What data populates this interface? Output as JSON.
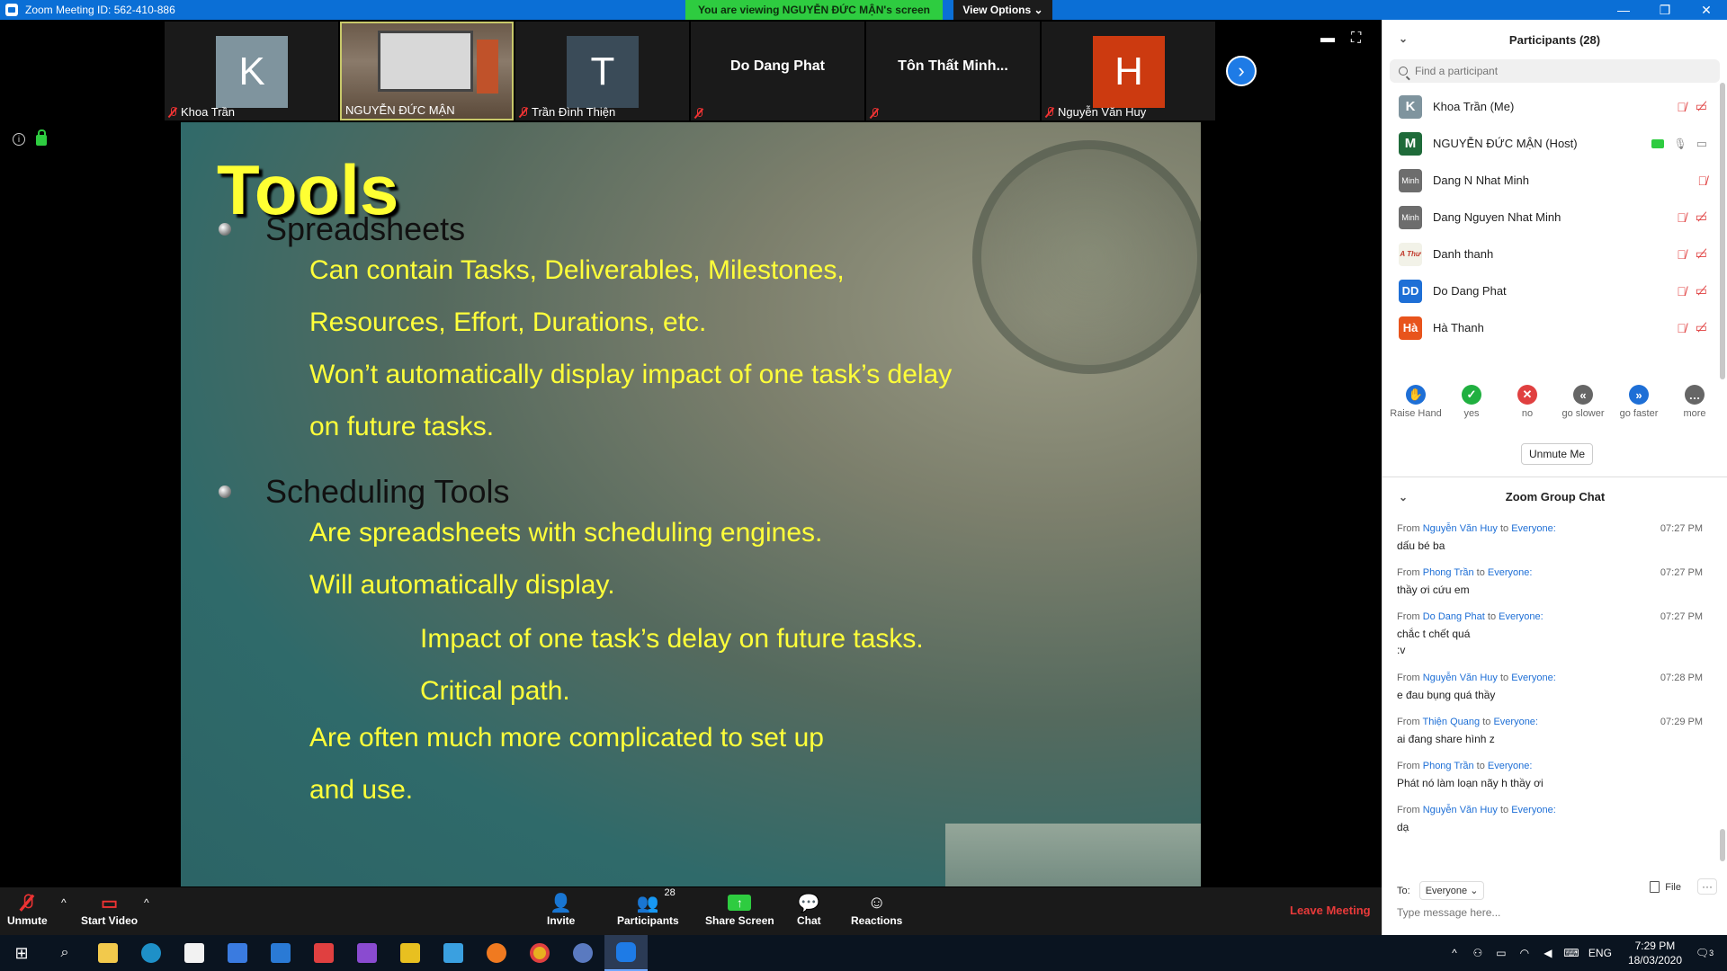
{
  "window": {
    "title": "Zoom Meeting ID: 562-410-886",
    "banner": "You are viewing NGUYỄN ĐỨC MẬN's screen",
    "view_options": "View Options"
  },
  "thumbnails": [
    {
      "type": "avatar",
      "initial": "K",
      "color": "#7f949e",
      "name": "Khoa Trần",
      "muted": true
    },
    {
      "type": "camera",
      "name": "NGUYỄN ĐỨC MẬN",
      "muted": false
    },
    {
      "type": "avatar",
      "initial": "T",
      "color": "#3a4b58",
      "name": "Trần Đình Thiện",
      "muted": true
    },
    {
      "type": "name",
      "display": "Do Dang Phat",
      "name": "",
      "muted": true
    },
    {
      "type": "name",
      "display": "Tôn Thất Minh...",
      "name": "",
      "muted": true
    },
    {
      "type": "avatar",
      "initial": "H",
      "color": "#cc3a10",
      "name": "Nguyễn Văn Huy",
      "muted": true
    }
  ],
  "slide": {
    "title": "Tools",
    "bullet1": "Spreadsheets",
    "b1_lines": [
      "Can contain Tasks, Deliverables, Milestones,",
      "Resources, Effort, Durations, etc.",
      "Won’t automatically display impact of one task’s delay",
      "on future tasks."
    ],
    "bullet2": "Scheduling Tools",
    "b2_lines": [
      "Are spreadsheets with scheduling engines.",
      "Will automatically display."
    ],
    "b2_sub": [
      "Impact of one task’s delay on future tasks.",
      "Critical path."
    ],
    "b2_tail": [
      "Are often much more complicated to set up",
      "and use."
    ]
  },
  "toolbar": {
    "unmute": "Unmute",
    "start_video": "Start Video",
    "invite": "Invite",
    "participants": "Participants",
    "participants_count": "28",
    "share_screen": "Share Screen",
    "chat": "Chat",
    "reactions": "Reactions",
    "leave": "Leave Meeting"
  },
  "participants_panel": {
    "title": "Participants (28)",
    "search_placeholder": "Find a participant",
    "list": [
      {
        "initial": "K",
        "color": "#7f949e",
        "name": "Khoa Trần (Me)",
        "icons": "mic-cam-off"
      },
      {
        "initial": "M",
        "color": "#1f6b3a",
        "name": "NGUYỄN ĐỨC MẬN (Host)",
        "icons": "host"
      },
      {
        "initial": "Minh",
        "color": "#6d6d6d",
        "name": "Dang N Nhat Minh",
        "icons": "mic-off"
      },
      {
        "initial": "Minh",
        "color": "#6d6d6d",
        "name": "Dang Nguyen Nhat Minh",
        "icons": "mic-cam-off"
      },
      {
        "initial": "A Thư",
        "color": "#f2f2e8",
        "name": "Danh thanh",
        "icons": "mic-cam-off"
      },
      {
        "initial": "DD",
        "color": "#1e6fd6",
        "name": "Do Dang Phat",
        "icons": "mic-cam-off"
      },
      {
        "initial": "Hà",
        "color": "#e8541c",
        "name": "Hà Thanh",
        "icons": "mic-cam-off"
      }
    ],
    "reactions": [
      {
        "label": "Raise Hand",
        "color": "#1e6fd6",
        "glyph": "✋"
      },
      {
        "label": "yes",
        "color": "#20b040",
        "glyph": "✓"
      },
      {
        "label": "no",
        "color": "#e04040",
        "glyph": "✕"
      },
      {
        "label": "go slower",
        "color": "#666666",
        "glyph": "«"
      },
      {
        "label": "go faster",
        "color": "#1e6fd6",
        "glyph": "»"
      },
      {
        "label": "more",
        "color": "#666666",
        "glyph": "…"
      }
    ],
    "unmute_me": "Unmute Me"
  },
  "chat": {
    "title": "Zoom Group Chat",
    "from_label": "From",
    "to_label": "to",
    "messages": [
      {
        "from": "Nguyễn Văn Huy",
        "to": "Everyone:",
        "time": "07:27 PM",
        "text": "dấu bé ba"
      },
      {
        "from": "Phong Trần",
        "to": "Everyone:",
        "time": "07:27 PM",
        "text": "thầy ơi cứu em"
      },
      {
        "from": "Do Dang Phat",
        "to": "Everyone:",
        "time": "07:27 PM",
        "text": "chắc t chết quá",
        "text2": ":v"
      },
      {
        "from": "Nguyễn Văn Huy",
        "to": "Everyone:",
        "time": "07:28 PM",
        "text": "e đau bụng quá thầy"
      },
      {
        "from": "Thiện Quang",
        "to": "Everyone:",
        "time": "07:29 PM",
        "text": "ai đang share hình z"
      },
      {
        "from": "Phong Trần",
        "to": "Everyone:",
        "time": "",
        "text": "Phát nó làm loạn nãy h thầy ơi"
      },
      {
        "from": "Nguyễn Văn Huy",
        "to": "Everyone:",
        "time": "",
        "text": "dạ"
      }
    ],
    "to_prefix": "To:",
    "to_value": "Everyone",
    "file": "File",
    "input_placeholder": "Type message here..."
  },
  "taskbar": {
    "lang": "ENG",
    "time": "7:29 PM",
    "date": "18/03/2020",
    "notifications": "3"
  }
}
